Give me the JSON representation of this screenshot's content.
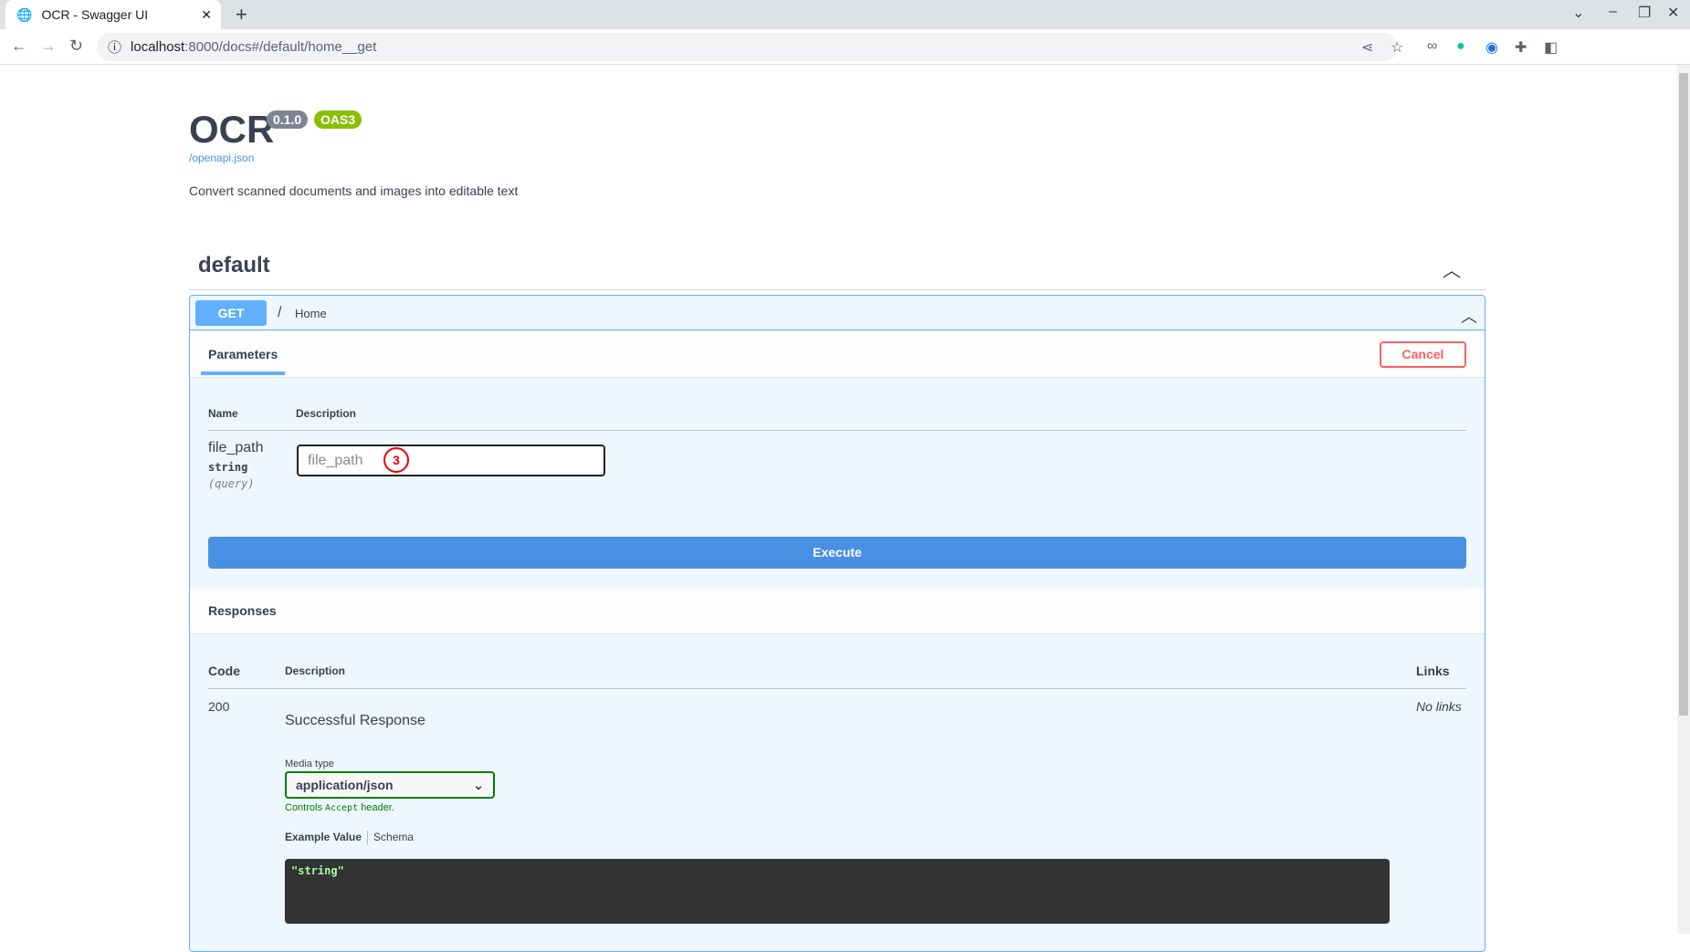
{
  "browser": {
    "tab_title": "OCR - Swagger UI",
    "url_host": "localhost",
    "url_rest": ":8000/docs#/default/home__get"
  },
  "header": {
    "title": "OCR",
    "version": "0.1.0",
    "oas": "OAS3",
    "spec_link": "/openapi.json",
    "description": "Convert scanned documents and images into editable text"
  },
  "section": {
    "name": "default"
  },
  "operation": {
    "method": "GET",
    "path": "/",
    "summary": "Home",
    "params_tab": "Parameters",
    "cancel": "Cancel",
    "col_name": "Name",
    "col_desc": "Description",
    "param": {
      "name": "file_path",
      "type": "string",
      "in": "(query)",
      "placeholder": "file_path"
    },
    "annotation": "3",
    "execute": "Execute"
  },
  "responses": {
    "title": "Responses",
    "col_code": "Code",
    "col_desc": "Description",
    "col_links": "Links",
    "rows": [
      {
        "code": "200",
        "description": "Successful Response",
        "links": "No links"
      }
    ],
    "media_type_label": "Media type",
    "media_type": "application/json",
    "controls_pre": "Controls",
    "controls_code": "Accept",
    "controls_post": "header.",
    "example_tab": "Example Value",
    "schema_tab": "Schema",
    "example": "\"string\""
  },
  "colors": {
    "get": "#61affe",
    "execute": "#4990e2",
    "cancel": "#ff6060",
    "oas": "#89bf04",
    "version": "#7d8492"
  }
}
